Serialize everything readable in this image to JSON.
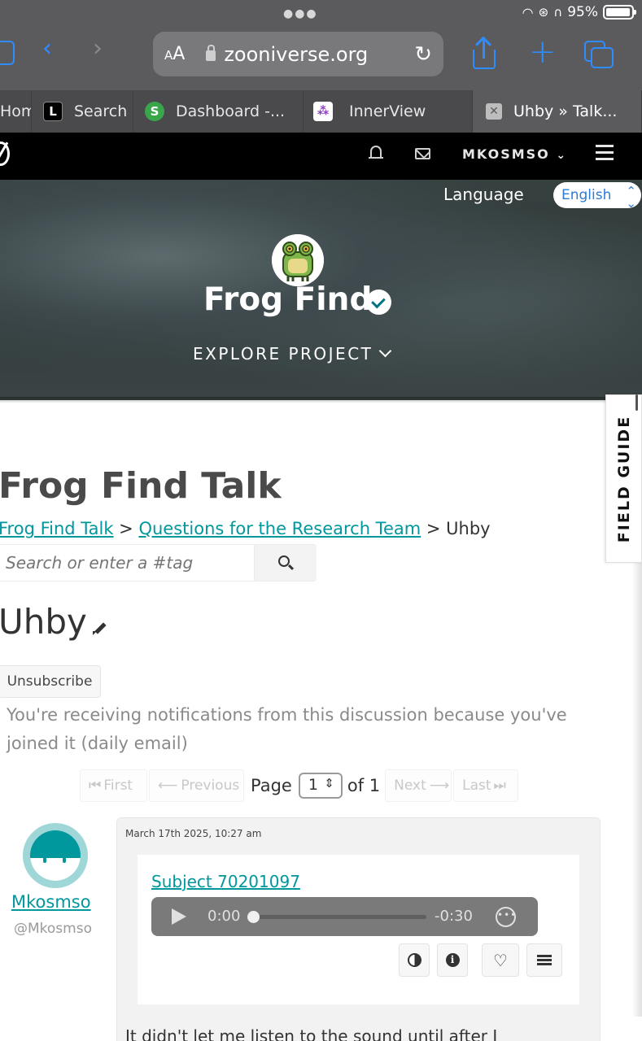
{
  "status": {
    "battery": "95%"
  },
  "browser": {
    "text_size_label": "AA",
    "url": "zooniverse.org",
    "tabs": [
      {
        "label": "Hom",
        "favicon": ""
      },
      {
        "label": "Search",
        "favicon": "L"
      },
      {
        "label": "Dashboard -...",
        "favicon": "S"
      },
      {
        "label": "InnerView",
        "favicon": "innerview-icon"
      },
      {
        "label": "Uhby » Talk...",
        "favicon": "close-icon",
        "active": true
      }
    ]
  },
  "zoo_header": {
    "username": "MKOSMSO"
  },
  "hero": {
    "language_label": "Language",
    "language_value": "English",
    "project_title": "Frog Find",
    "explore_label": "EXPLORE PROJECT"
  },
  "field_guide_label": "FIELD GUIDE",
  "talk": {
    "title": "Frog Find Talk",
    "breadcrumb": {
      "crumb1": "Frog Find Talk",
      "sep1": " > ",
      "crumb2": "Questions for the Research Team",
      "sep2": " > ",
      "current": "Uhby"
    },
    "search_placeholder": "Search or enter a #tag",
    "discussion_title": "Uhby",
    "unsubscribe_label": "Unsubscribe",
    "notification_text": "You're receiving notifications from this discussion because you've joined it (daily email)"
  },
  "pagination": {
    "first": "First",
    "previous": "Previous",
    "page_label": "Page",
    "current_page": "1",
    "of_label": "of 1",
    "next": "Next",
    "last": "Last"
  },
  "comment": {
    "author_name": "Mkosmso",
    "author_handle": "@Mkosmso",
    "timestamp": "March 17th 2025, 10:27 am",
    "subject_link": "Subject 70201097",
    "audio": {
      "current_time": "0:00",
      "remaining_time": "-0:30",
      "progress": 0
    },
    "body_preview": "It didn't let me listen to the sound until after I"
  },
  "colors": {
    "accent": "#00979d",
    "link_blue": "#2f8cff",
    "chrome_bg": "#5b5b5e"
  }
}
